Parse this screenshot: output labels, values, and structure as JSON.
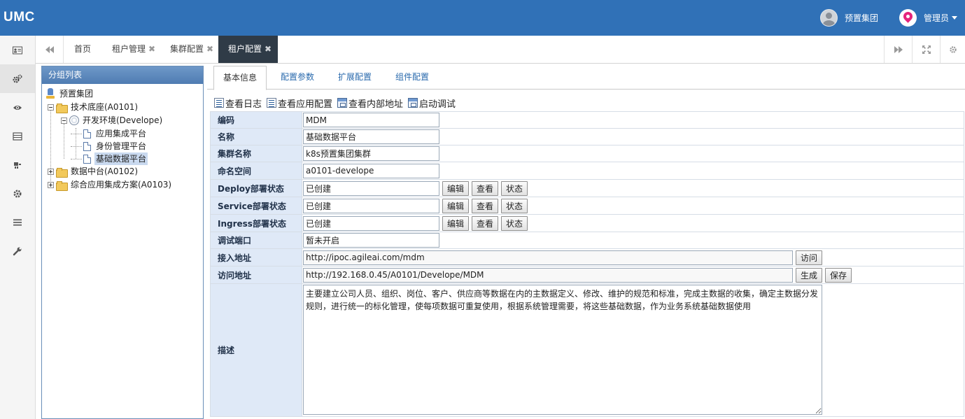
{
  "header": {
    "logo": "UMC",
    "group_name": "预置集团",
    "user_name": "管理员"
  },
  "rail": {
    "icons": [
      "id-card-icon",
      "gears-icon",
      "eye-icon",
      "list-icon",
      "sitemap-icon",
      "gear-icon",
      "bars-icon",
      "wrench-icon"
    ]
  },
  "tabs": [
    {
      "label": "首页",
      "closable": false
    },
    {
      "label": "租户管理",
      "closable": true
    },
    {
      "label": "集群配置",
      "closable": true
    },
    {
      "label": "租户配置",
      "closable": true,
      "active": true
    }
  ],
  "tab_close_glyph": "✖",
  "tree": {
    "title": "分组列表",
    "nodes": [
      {
        "label": "预置集团"
      },
      {
        "label": "技术底座(A0101)"
      },
      {
        "label": "开发环境(Develope)"
      },
      {
        "label": "应用集成平台"
      },
      {
        "label": "身份管理平台"
      },
      {
        "label": "基础数据平台",
        "selected": true
      },
      {
        "label": "数据中台(A0102)"
      },
      {
        "label": "综合应用集成方案(A0103)"
      }
    ]
  },
  "subtabs": [
    "基本信息",
    "配置参数",
    "扩展配置",
    "组件配置"
  ],
  "toolbar": [
    "查看日志",
    "查看应用配置",
    "查看内部地址",
    "启动调试"
  ],
  "form": {
    "code": {
      "label": "编码",
      "value": "MDM"
    },
    "name": {
      "label": "名称",
      "value": "基础数据平台"
    },
    "cluster": {
      "label": "集群名称",
      "value": "k8s预置集团集群"
    },
    "namespace": {
      "label": "命名空间",
      "value": "a0101-develope"
    },
    "deploy": {
      "label": "Deploy部署状态",
      "value": "已创建"
    },
    "service": {
      "label": "Service部署状态",
      "value": "已创建"
    },
    "ingress": {
      "label": "Ingress部署状态",
      "value": "已创建"
    },
    "debug_port": {
      "label": "调试端口",
      "value": "暂未开启"
    },
    "access_entry": {
      "label": "接入地址",
      "value": "http://ipoc.agileai.com/mdm"
    },
    "access_url": {
      "label": "访问地址",
      "value": "http://192.168.0.45/A0101/Develope/MDM"
    },
    "description": {
      "label": "描述",
      "value": "主要建立公司人员、组织、岗位、客户、供应商等数据在内的主数据定义、修改、维护的规范和标准，完成主数据的收集，确定主数据分发规则，进行统一的标化管理，使每项数据可重复使用，根据系统管理需要，将这些基础数据，作为业务系统基础数据使用"
    }
  },
  "buttons": {
    "edit": "编辑",
    "view": "查看",
    "status": "状态",
    "visit": "访问",
    "generate": "生成",
    "save": "保存"
  }
}
